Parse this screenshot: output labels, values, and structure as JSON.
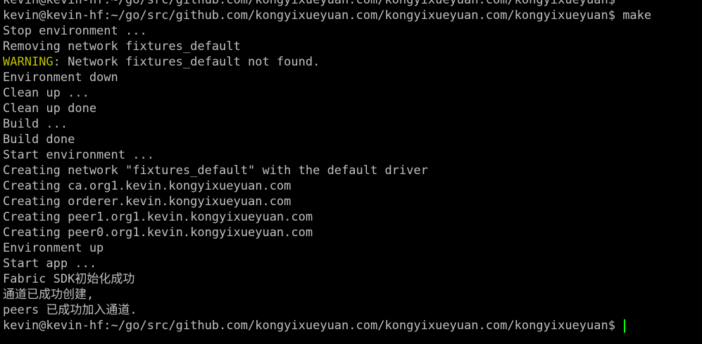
{
  "terminal": {
    "colors": {
      "background": "#000000",
      "text": "#c0c0c0",
      "warning": "#c0c000",
      "cursor": "#00ff00"
    },
    "top_partial_line": "kevin@kevin-hf:~/go/src/github.com/kongyixueyuan.com/kongyixueyuan.com/kongyixueyuan$",
    "command_line": "kevin@kevin-hf:~/go/src/github.com/kongyixueyuan.com/kongyixueyuan.com/kongyixueyuan$ make",
    "output": [
      "Stop environment ...",
      "Removing network fixtures_default"
    ],
    "warning": {
      "label": "WARNING",
      "message": ": Network fixtures_default not found."
    },
    "output_after_warning": [
      "Environment down",
      "Clean up ...",
      "Clean up done",
      "Build ...",
      "Build done",
      "Start environment ...",
      "Creating network \"fixtures_default\" with the default driver",
      "Creating ca.org1.kevin.kongyixueyuan.com",
      "Creating orderer.kevin.kongyixueyuan.com",
      "Creating peer1.org1.kevin.kongyixueyuan.com",
      "Creating peer0.org1.kevin.kongyixueyuan.com",
      "Environment up",
      "Start app ...",
      "Fabric SDK初始化成功",
      "通道已成功创建,",
      "peers 已成功加入通道."
    ],
    "prompt": "kevin@kevin-hf:~/go/src/github.com/kongyixueyuan.com/kongyixueyuan.com/kongyixueyuan$ "
  }
}
